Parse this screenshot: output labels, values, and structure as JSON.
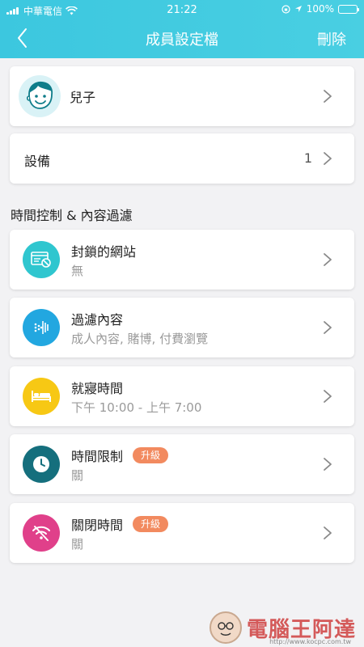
{
  "status": {
    "carrier": "中華電信",
    "time": "21:22",
    "battery": "100%"
  },
  "nav": {
    "title": "成員設定檔",
    "delete_label": "刪除"
  },
  "profile": {
    "name": "兒子"
  },
  "devices": {
    "label": "設備",
    "count": "1"
  },
  "section": {
    "title": "時間控制 & 內容過濾"
  },
  "rows": [
    {
      "title": "封鎖的網站",
      "subtitle": "無",
      "icon": "blocked-website-icon",
      "color": "#2fc6cf"
    },
    {
      "title": "過濾內容",
      "subtitle": "成人內容, 賭博, 付費瀏覽",
      "icon": "content-filter-icon",
      "color": "#22a7e0"
    },
    {
      "title": "就寢時間",
      "subtitle": "下午 10:00 - 上午 7:00",
      "icon": "bed-icon",
      "color": "#f7c814"
    },
    {
      "title": "時間限制",
      "subtitle": "關",
      "badge": "升級",
      "icon": "clock-icon",
      "color": "#156f7d"
    },
    {
      "title": "關閉時間",
      "subtitle": "關",
      "badge": "升級",
      "icon": "wifi-off-icon",
      "color": "#e0408a"
    }
  ],
  "colors": {
    "header": "#3cc7df",
    "badge": "#f28a5f"
  },
  "watermark": {
    "text": "電腦王阿達",
    "url": "http://www.kocpc.com.tw"
  }
}
